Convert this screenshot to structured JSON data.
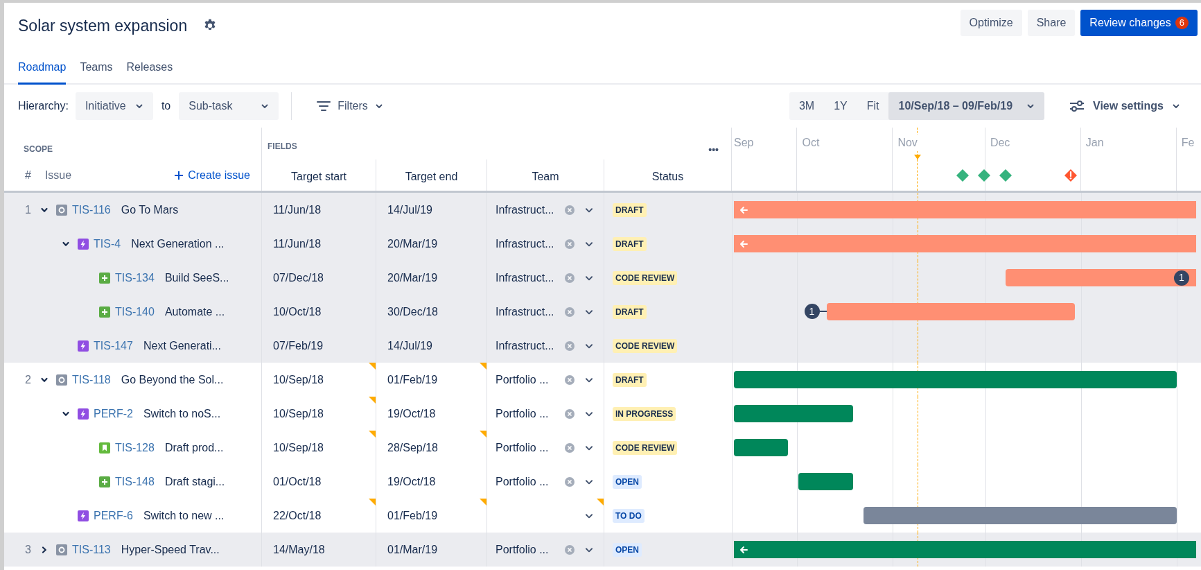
{
  "title": "Solar system expansion",
  "header_buttons": [
    {
      "label": "Optimize",
      "kind": "subtle"
    },
    {
      "label": "Share",
      "kind": "subtle"
    },
    {
      "label": "Review changes",
      "kind": "primary",
      "badge": "6"
    }
  ],
  "tabs": [
    {
      "label": "Roadmap",
      "selected": true
    },
    {
      "label": "Teams",
      "selected": false
    },
    {
      "label": "Releases",
      "selected": false
    }
  ],
  "toolbar": {
    "hierarchy_label": "Hierarchy:",
    "from": "Initiative",
    "connector": "to",
    "to": "Sub-task",
    "filters": "Filters",
    "zoom_options": [
      {
        "label": "3M",
        "selected": false
      },
      {
        "label": "1Y",
        "selected": false
      },
      {
        "label": "Fit",
        "selected": false
      },
      {
        "label": "10/Sep/18 – 09/Feb/19",
        "selected": true
      }
    ],
    "view_settings": "View settings"
  },
  "scope_header": "SCOPE",
  "fields_header": "FIELDS",
  "more": "•••",
  "issue_columns": {
    "number": "#",
    "issue": "Issue",
    "create": "Create issue"
  },
  "field_columns": [
    "Target start",
    "Target end",
    "Team",
    "Status"
  ],
  "timeline": {
    "months": [
      "Sep",
      "Oct",
      "Nov",
      "Dec",
      "Jan",
      "Fe"
    ],
    "milestones": [
      {
        "kind": "release"
      },
      {
        "kind": "release"
      },
      {
        "kind": "release"
      },
      {
        "kind": "warning"
      }
    ]
  },
  "issues": [
    {
      "number": "1",
      "expanded": true,
      "kind": "initiative",
      "key": "TIS-116",
      "summary": "Go To Mars",
      "target_start": "11/Jun/18",
      "target_end": "14/Jul/19",
      "team": "Infrastruct...",
      "status": {
        "text": "DRAFT",
        "color": "#fff0b3"
      },
      "bar": {
        "color": "#ff8f73"
      },
      "start_changed": false,
      "end_changed": false,
      "team_changed": false,
      "children": [
        {
          "expanded": true,
          "kind": "epic",
          "key": "TIS-4",
          "summary": "Next Generation ...",
          "target_start": "11/Jun/18",
          "target_end": "20/Mar/19",
          "team": "Infrastruct...",
          "status": {
            "text": "DRAFT",
            "color": "#fff0b3"
          },
          "bar": {
            "color": "#ff8f73"
          },
          "start_changed": false,
          "end_changed": false,
          "team_changed": false,
          "children": [
            {
              "kind": "feature",
              "key": "TIS-134",
              "summary": "Build SeeS...",
              "target_start": "07/Dec/18",
              "target_end": "20/Mar/19",
              "team": "Infrastruct...",
              "status": {
                "text": "CODE REVIEW",
                "color": "#fff0b3"
              },
              "bar": {
                "color": "#ff8f73"
              },
              "start_changed": false,
              "end_changed": false,
              "team_changed": false,
              "dependency": {
                "label": "1",
                "kind": "end"
              }
            },
            {
              "kind": "feature",
              "key": "TIS-140",
              "summary": "Automate ...",
              "target_start": "10/Oct/18",
              "target_end": "30/Dec/18",
              "team": "Infrastruct...",
              "status": {
                "text": "DRAFT",
                "color": "#fff0b3"
              },
              "bar": {
                "color": "#ff8f73"
              },
              "start_changed": false,
              "end_changed": false,
              "team_changed": false,
              "dependency": {
                "label": "1",
                "kind": "start"
              }
            }
          ]
        },
        {
          "kind": "epic",
          "key": "TIS-147",
          "summary": "Next Generati...",
          "target_start": "07/Feb/19",
          "target_end": "14/Jul/19",
          "team": "Infrastruct...",
          "status": {
            "text": "CODE REVIEW",
            "color": "#fff0b3"
          },
          "start_changed": false,
          "end_changed": false,
          "team_changed": false
        }
      ]
    },
    {
      "number": "2",
      "expanded": true,
      "kind": "initiative",
      "key": "TIS-118",
      "summary": "Go Beyond the Sol...",
      "target_start": "10/Sep/18",
      "target_end": "01/Feb/19",
      "team": "Portfolio ...",
      "status": {
        "text": "DRAFT",
        "color": "#fff0b3"
      },
      "bar": {
        "color": "#00875a"
      },
      "start_changed": true,
      "end_changed": true,
      "team_changed": false,
      "children": [
        {
          "expanded": true,
          "kind": "epic",
          "key": "PERF-2",
          "summary": "Switch to noS...",
          "target_start": "10/Sep/18",
          "target_end": "19/Oct/18",
          "team": "Portfolio ...",
          "status": {
            "text": "IN PROGRESS",
            "color": "#fff0b3"
          },
          "bar": {
            "color": "#00875a"
          },
          "start_changed": true,
          "end_changed": false,
          "team_changed": false,
          "children": [
            {
              "kind": "story",
              "key": "TIS-128",
              "summary": "Draft prod...",
              "target_start": "10/Sep/18",
              "target_end": "28/Sep/18",
              "team": "Portfolio ...",
              "status": {
                "text": "CODE REVIEW",
                "color": "#fff0b3"
              },
              "bar": {
                "color": "#00875a"
              },
              "start_changed": true,
              "end_changed": true,
              "team_changed": false
            },
            {
              "kind": "feature",
              "key": "TIS-148",
              "summary": "Draft stagi...",
              "target_start": "01/Oct/18",
              "target_end": "19/Oct/18",
              "team": "Portfolio ...",
              "status": {
                "text": "OPEN",
                "color": "#deebff"
              },
              "bar": {
                "color": "#00875a"
              },
              "start_changed": false,
              "end_changed": false,
              "team_changed": false
            }
          ]
        },
        {
          "kind": "epic",
          "key": "PERF-6",
          "summary": "Switch to new ...",
          "target_start": "22/Oct/18",
          "target_end": "01/Feb/19",
          "status": {
            "text": "TO DO",
            "color": "#deebff"
          },
          "bar": {
            "color": "#7a869a"
          },
          "start_changed": true,
          "end_changed": true,
          "team_changed": true
        }
      ]
    },
    {
      "number": "3",
      "expanded": false,
      "kind": "initiative",
      "key": "TIS-113",
      "summary": "Hyper-Speed Trav...",
      "target_start": "14/May/18",
      "target_end": "01/Mar/19",
      "team": "Portfolio ...",
      "status": {
        "text": "OPEN",
        "color": "#deebff"
      },
      "bar": {
        "color": "#00875a"
      },
      "start_changed": false,
      "end_changed": false,
      "team_changed": false
    }
  ]
}
